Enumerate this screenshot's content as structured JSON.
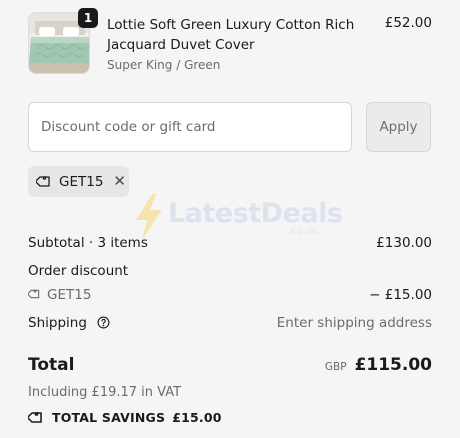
{
  "product": {
    "title": "Lottie Soft Green Luxury Cotton Rich Jacquard Duvet Cover",
    "variant": "Super King / Green",
    "price": "£52.00",
    "quantity": "1",
    "image_icon": "bedding-product-image"
  },
  "discount": {
    "placeholder": "Discount code or gift card",
    "value": "",
    "apply_label": "Apply"
  },
  "applied_code": {
    "code": "GET15",
    "remove_icon": "close-icon"
  },
  "watermark": {
    "text": "LatestDeals",
    "sub": ".co.uk"
  },
  "summary": {
    "subtotal_label": "Subtotal · 3 items",
    "subtotal_value": "£130.00",
    "order_discount_label": "Order discount",
    "discount_code": "GET15",
    "discount_value": "− £15.00",
    "shipping_label": "Shipping",
    "shipping_value": "Enter shipping address",
    "total_label": "Total",
    "currency": "GBP",
    "total_value": "£115.00",
    "vat_note": "Including £19.17 in VAT",
    "savings_label": "TOTAL SAVINGS",
    "savings_value": "£15.00"
  },
  "colors": {
    "background": "#f5f5f5",
    "text": "#1a1a1a",
    "muted": "#6b6b6b",
    "chip": "#e6e6e6"
  }
}
